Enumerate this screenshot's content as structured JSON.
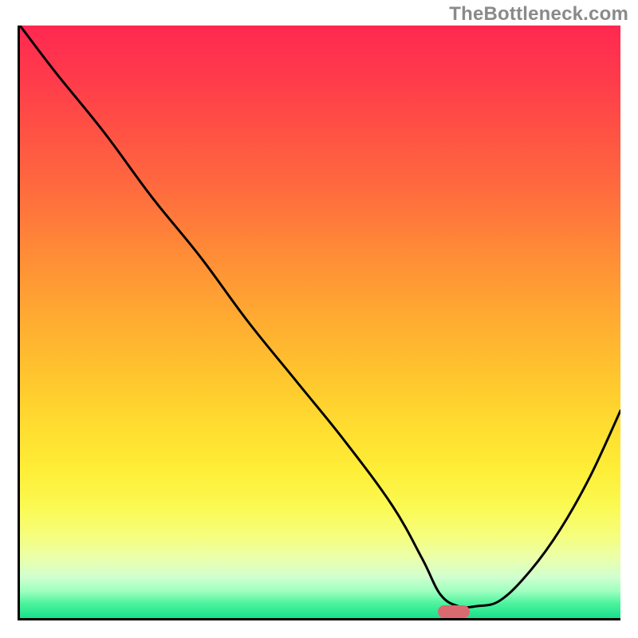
{
  "watermark": "TheBottleneck.com",
  "chart_data": {
    "type": "line",
    "title": "",
    "xlabel": "",
    "ylabel": "",
    "xlim": [
      0,
      100
    ],
    "ylim": [
      0,
      100
    ],
    "legend": false,
    "grid": false,
    "gradient_stops": [
      {
        "pct": 0,
        "color": "#ff2850"
      },
      {
        "pct": 9,
        "color": "#ff3b4b"
      },
      {
        "pct": 18,
        "color": "#ff5244"
      },
      {
        "pct": 28,
        "color": "#ff6c3e"
      },
      {
        "pct": 38,
        "color": "#ff8a37"
      },
      {
        "pct": 48,
        "color": "#ffa732"
      },
      {
        "pct": 58,
        "color": "#ffc22e"
      },
      {
        "pct": 67,
        "color": "#ffdb2f"
      },
      {
        "pct": 75,
        "color": "#feee37"
      },
      {
        "pct": 81,
        "color": "#fbf951"
      },
      {
        "pct": 86,
        "color": "#f6fe7b"
      },
      {
        "pct": 90,
        "color": "#eaffac"
      },
      {
        "pct": 93,
        "color": "#d2ffcf"
      },
      {
        "pct": 95.5,
        "color": "#9dffbf"
      },
      {
        "pct": 97.5,
        "color": "#4ef39e"
      },
      {
        "pct": 100,
        "color": "#18e18a"
      }
    ],
    "series": [
      {
        "name": "bottleneck-curve",
        "x": [
          0,
          6,
          14,
          22,
          30,
          38,
          46,
          54,
          62,
          67,
          70,
          73,
          76,
          80,
          85,
          90,
          95,
          100
        ],
        "y": [
          100,
          92,
          82,
          71,
          61,
          50,
          40,
          30,
          19,
          10,
          4,
          2,
          2,
          3,
          8,
          15,
          24,
          35
        ]
      }
    ],
    "marker": {
      "x": 72,
      "y": 1.5,
      "color": "#d96a6f"
    },
    "axes": {
      "left": true,
      "bottom": true,
      "ticks": []
    }
  }
}
